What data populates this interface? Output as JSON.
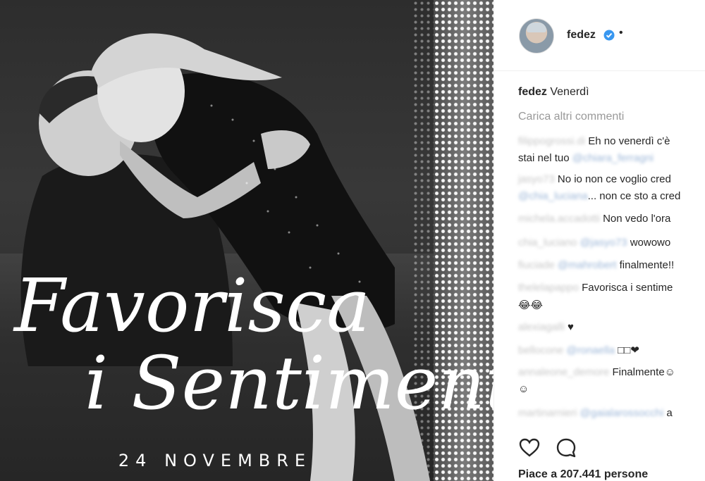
{
  "photo": {
    "script_line1": "Favorisca",
    "script_line2": "i Sentimenti",
    "date": "24 NOVEMBRE"
  },
  "post": {
    "username": "fedez",
    "dot": "•",
    "caption_user": "fedez",
    "caption_text": "Venerdì",
    "load_more": "Carica altri commenti"
  },
  "comments": [
    {
      "user": "filippogrossi.di",
      "text": "Eh no venerdì c'è",
      "line2_prefix": "stai nel tuo",
      "mention": "@chiara_ferragni"
    },
    {
      "user": "jasyo73",
      "text": "No io non ce voglio cred",
      "line2_mention": "@chia_luciana",
      "line2_text": "... non ce sto a cred"
    },
    {
      "user": "michela.accadotti",
      "text": "Non vedo l'ora"
    },
    {
      "user": "chia_luciano",
      "mention": "@jasyo73",
      "text": "wowowo"
    },
    {
      "user": "fiuciade",
      "mention": "@mahrobert",
      "text": "finalmente!!"
    },
    {
      "user": "thelelapappo",
      "text": "Favorisca i sentime",
      "line2_text": "😂😂"
    },
    {
      "user": "alexiagalli",
      "text": "♥"
    },
    {
      "user": "bellocone",
      "mention": "@ronaella",
      "text": "□□❤"
    },
    {
      "user": "annaleone_demore",
      "text": "Finalmente☺",
      "line2_text": "☺"
    },
    {
      "user": "martinarnieri",
      "mention": "@gaialarossocchi",
      "text": "a"
    }
  ],
  "likes_text": "Piace a 207.441 persone",
  "icons": [
    "verified-badge-icon",
    "heart-icon",
    "comment-icon"
  ],
  "colors": {
    "verified": "#3897f0",
    "muted": "#999999"
  }
}
